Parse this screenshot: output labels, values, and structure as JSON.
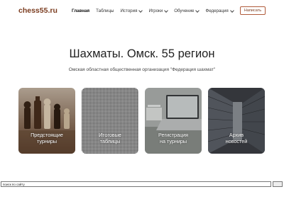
{
  "header": {
    "logo": "chess55.ru",
    "nav": [
      {
        "label": "Главная",
        "dropdown": false,
        "active": true
      },
      {
        "label": "Таблицы",
        "dropdown": false,
        "active": false
      },
      {
        "label": "История",
        "dropdown": true,
        "active": false
      },
      {
        "label": "Игроки",
        "dropdown": true,
        "active": false
      },
      {
        "label": "Обучение",
        "dropdown": true,
        "active": false
      },
      {
        "label": "Федерация",
        "dropdown": true,
        "active": false
      }
    ],
    "write_button": "Написать"
  },
  "hero": {
    "title": "Шахматы. Омск. 55 регион",
    "subtitle": "Омская областная общественная организация \"Федерация шахмат\""
  },
  "cards": [
    {
      "line1": "Предстоящие",
      "line2": "турниры"
    },
    {
      "line1": "Итоговые",
      "line2": "таблицы"
    },
    {
      "line1": "Регистрация",
      "line2": "на турниры"
    },
    {
      "line1": "Архив",
      "line2": "новостей"
    }
  ],
  "search": {
    "value": "поиск по сайту"
  },
  "colors": {
    "brand": "#7a3b1e",
    "button_border": "#b05a3a"
  }
}
